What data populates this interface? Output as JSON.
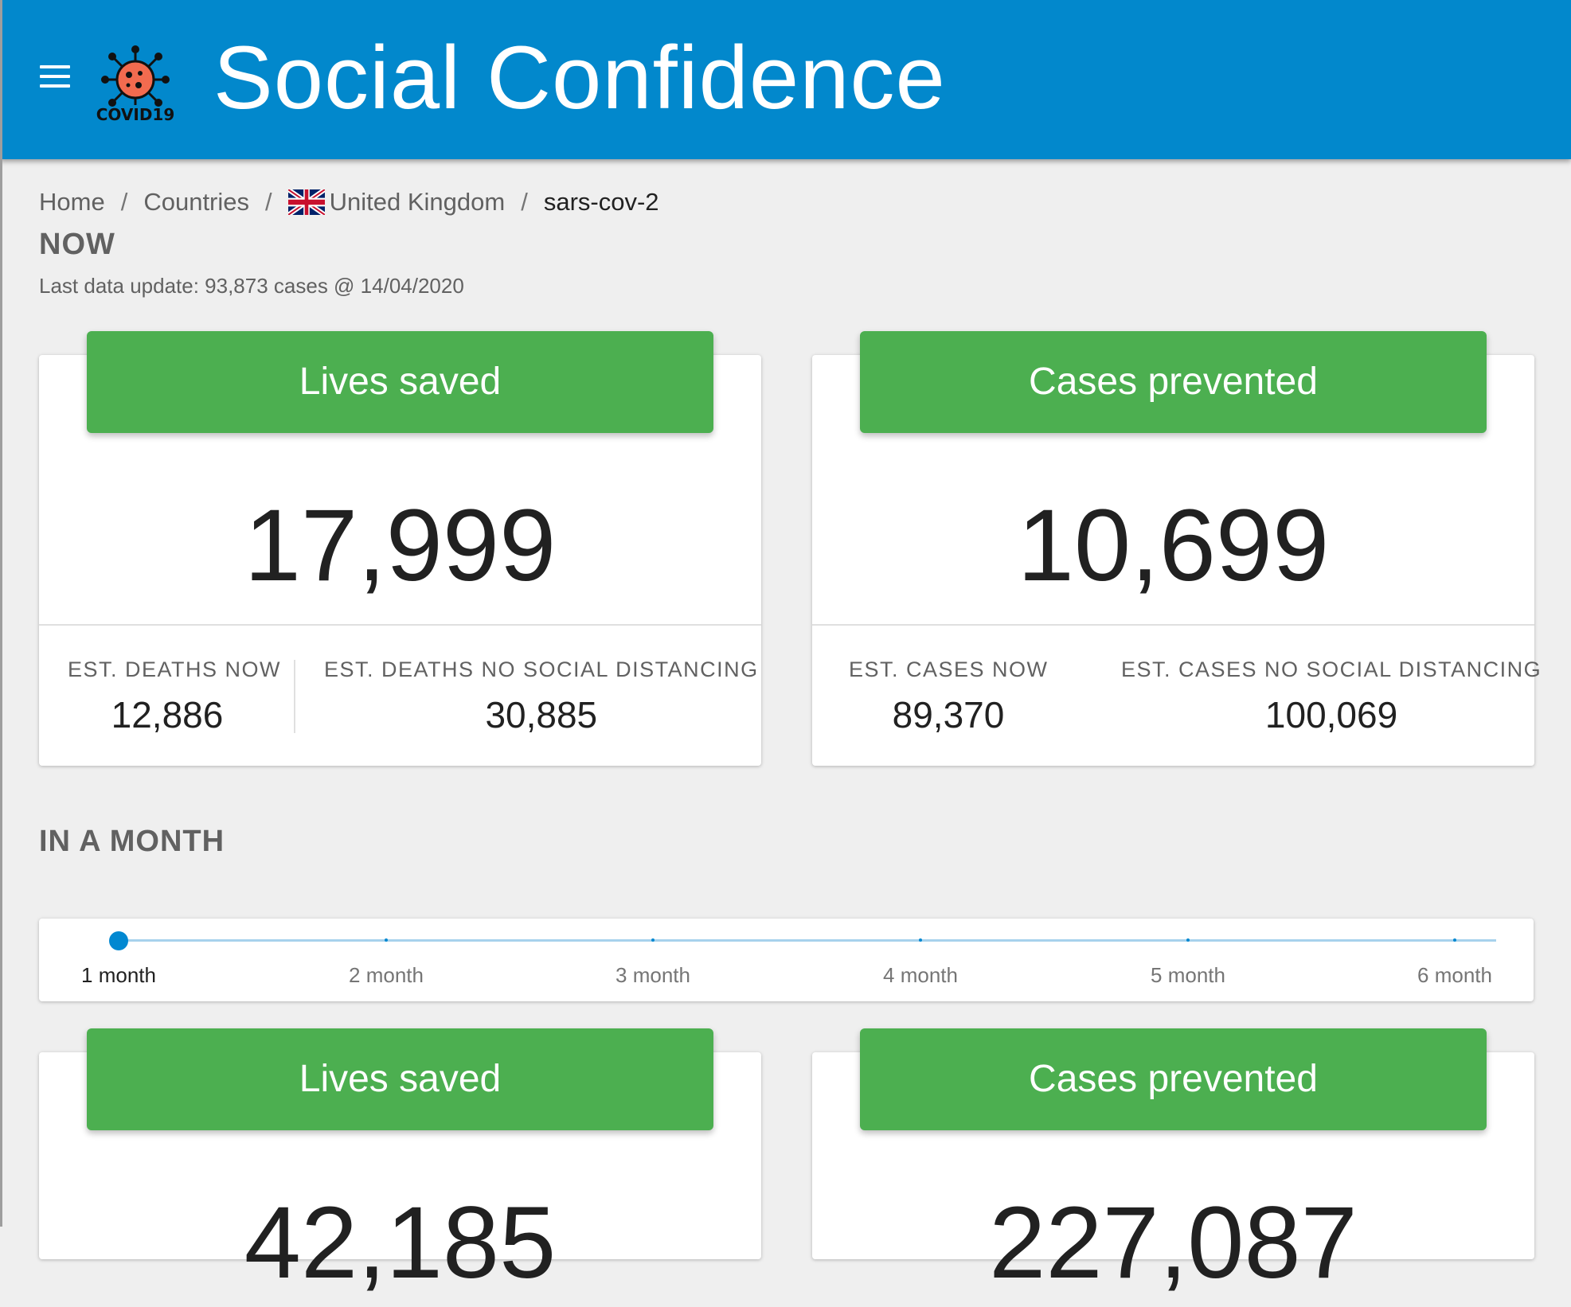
{
  "app": {
    "title": "Social Confidence",
    "logo_text": "COVID19",
    "menu_icon": "menu-icon"
  },
  "breadcrumb": {
    "home": "Home",
    "countries": "Countries",
    "country": "United Kingdom",
    "current": "sars-cov-2",
    "separator": "/"
  },
  "now": {
    "title": "NOW",
    "last_update": "Last data update: 93,873 cases @ 14/04/2020",
    "lives_card": {
      "header": "Lives saved",
      "value": "17,999",
      "left_label": "EST. DEATHS NOW",
      "left_value": "12,886",
      "right_label": "EST. DEATHS NO SOCIAL DISTANCING",
      "right_value": "30,885"
    },
    "cases_card": {
      "header": "Cases prevented",
      "value": "10,699",
      "left_label": "EST. CASES NOW",
      "left_value": "89,370",
      "right_label": "EST. CASES NO SOCIAL DISTANCING",
      "right_value": "100,069"
    }
  },
  "month": {
    "title": "IN A MONTH",
    "slider": {
      "labels": [
        "1 month",
        "2 month",
        "3 month",
        "4 month",
        "5 month",
        "6 month"
      ],
      "selected_index": 0
    },
    "lives_card": {
      "header": "Lives saved",
      "value": "42,185"
    },
    "cases_card": {
      "header": "Cases prevented",
      "value": "227,087"
    }
  },
  "colors": {
    "appbar": "#0288cc",
    "accent_green": "#4caf50",
    "slider_blue": "#0288d1"
  }
}
